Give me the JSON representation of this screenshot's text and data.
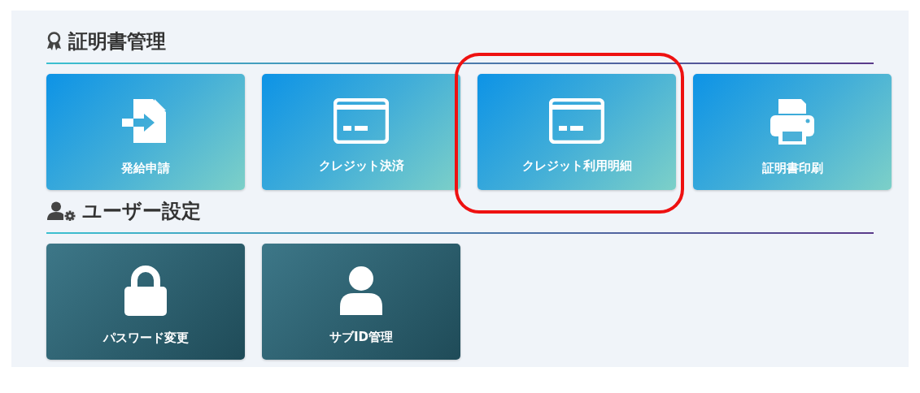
{
  "sections": [
    {
      "title": "証明書管理",
      "tiles": [
        {
          "label": "発給申請",
          "highlighted": false
        },
        {
          "label": "クレジット決済",
          "highlighted": false
        },
        {
          "label": "クレジット利用明細",
          "highlighted": true
        },
        {
          "label": "証明書印刷",
          "highlighted": false
        }
      ]
    },
    {
      "title": "ユーザー設定",
      "tiles": [
        {
          "label": "パスワード変更",
          "highlighted": false
        },
        {
          "label": "サブID管理",
          "highlighted": false
        }
      ]
    }
  ]
}
